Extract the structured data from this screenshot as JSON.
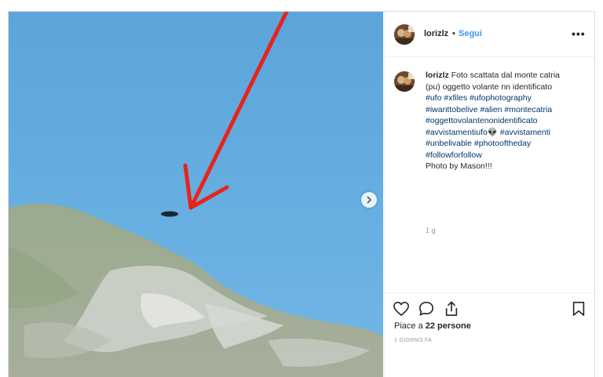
{
  "post": {
    "username": "lorizlz",
    "separator": "•",
    "follow_label": "Segui",
    "more_label": "•••",
    "caption": {
      "username": "lorizlz",
      "text_line1": "Foto scattata dal monte catria",
      "text_line2": "(pu) oggetto volante nn identificato",
      "hashtags": [
        "#ufo",
        "#xfiles",
        "#ufophotography",
        "#iwanttobelive",
        "#alien",
        "#montecatria",
        "#oggettovolantenonidentificato",
        "#avvistamentiufo",
        "👽",
        "#avvistamenti",
        "#unbelivable",
        "#photooftheday",
        "#followforfollow"
      ],
      "signature": "Photo by Mason!!!",
      "time": "1 g"
    },
    "likes_prefix": "Piace a ",
    "likes_count": "22 persone",
    "posted_ago": "1 GIORNO FA",
    "icons": {
      "like": "heart-icon",
      "comment": "comment-icon",
      "share": "share-icon",
      "save": "bookmark-icon",
      "next": "chevron-right-icon"
    },
    "colors": {
      "link": "#3897f0",
      "hashtag": "#003569",
      "sky": "#5aa3d8",
      "arrow": "#e8231c"
    }
  }
}
